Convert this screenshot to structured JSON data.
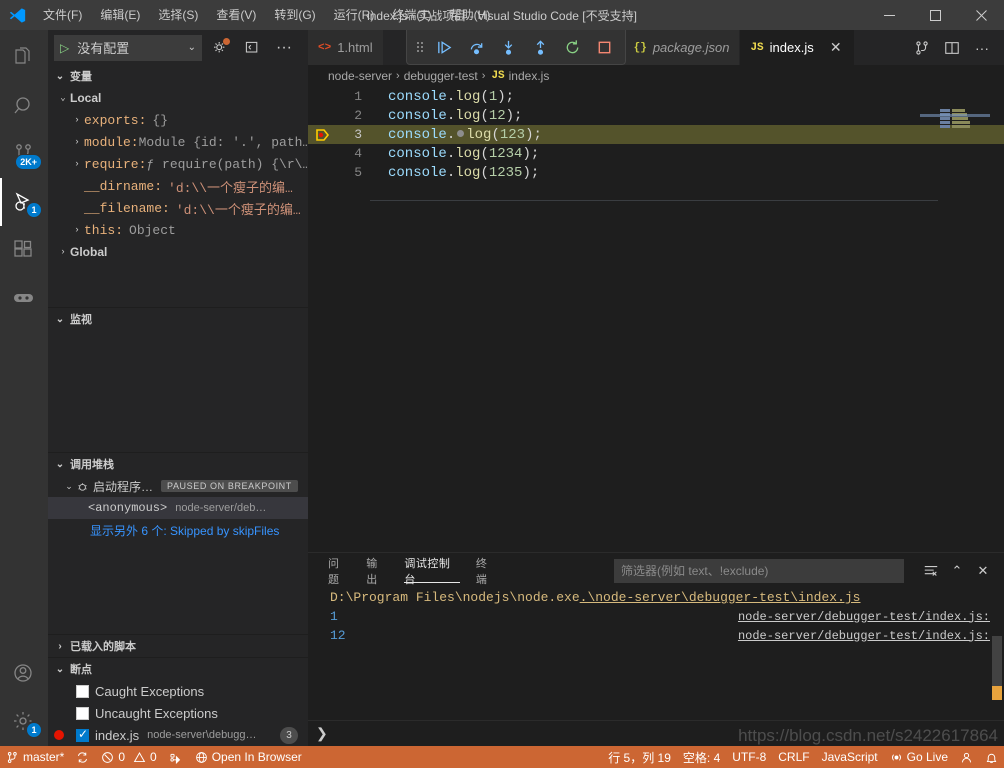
{
  "window": {
    "title": "index.js - 实战项目 - Visual Studio Code [不受支持]",
    "minimize": "—",
    "maximize": "□",
    "close": "✕"
  },
  "menu": {
    "items": [
      {
        "label": "文件(F)",
        "name": "menu-file"
      },
      {
        "label": "编辑(E)",
        "name": "menu-edit"
      },
      {
        "label": "选择(S)",
        "name": "menu-selection"
      },
      {
        "label": "查看(V)",
        "name": "menu-view"
      },
      {
        "label": "转到(G)",
        "name": "menu-go"
      },
      {
        "label": "运行(R)",
        "name": "menu-run"
      },
      {
        "label": "终端(T)",
        "name": "menu-terminal"
      },
      {
        "label": "帮助(H)",
        "name": "menu-help"
      }
    ]
  },
  "activitybar": {
    "explorer_badge": "",
    "scm_badge": "2K+",
    "debug_badge": "1",
    "settings_badge": "1"
  },
  "debugbar": {
    "config_label": "没有配置",
    "play_glyph": "▷",
    "chevron": "⌄",
    "gear_title": "打开“launch.json”",
    "more_title": "视图和更多操作...",
    "more_glyph": "···"
  },
  "debug_toolbar": {
    "continue": "继续",
    "step_over": "单步跳过",
    "step_into": "单步调试",
    "step_out": "单步跳出",
    "restart": "重启",
    "stop": "停止"
  },
  "sidebar": {
    "variables": {
      "title": "变量",
      "chevron": "⌄",
      "scopes": [
        {
          "name": "Local",
          "expanded": true,
          "chevron": "⌄",
          "rows": [
            {
              "twisty": "›",
              "name": "exports:",
              "value": "{}",
              "kind": "obj"
            },
            {
              "twisty": "›",
              "name": "module:",
              "value": "Module {id: '.', path…",
              "kind": "obj"
            },
            {
              "twisty": "›",
              "name": "require:",
              "value": "ƒ require(path) {\\r\\…",
              "kind": "fn"
            },
            {
              "twisty": "",
              "name": "__dirname:",
              "value": "'d:\\\\一个瘦子的编…",
              "kind": "str"
            },
            {
              "twisty": "",
              "name": "__filename:",
              "value": "'d:\\\\一个瘦子的编…",
              "kind": "str"
            },
            {
              "twisty": "›",
              "name": "this:",
              "value": "Object",
              "kind": "obj"
            }
          ]
        },
        {
          "name": "Global",
          "expanded": false,
          "chevron": "›",
          "rows": []
        }
      ]
    },
    "watch": {
      "title": "监视",
      "chevron": "⌄",
      "items": []
    },
    "callstack": {
      "title": "调用堆栈",
      "chevron": "⌄",
      "session": {
        "label": "启动程序…",
        "chevron": "⌄",
        "badge": "PAUSED ON BREAKPOINT"
      },
      "frames": [
        {
          "fn": "<anonymous>",
          "location": "node-server/deb…",
          "selected": true
        }
      ],
      "more": "显示另外 6 个: Skipped by skipFiles"
    },
    "loaded_scripts": {
      "title": "已载入的脚本",
      "chevron": "›"
    },
    "breakpoints": {
      "title": "断点",
      "chevron": "⌄",
      "items": [
        {
          "label": "Caught Exceptions",
          "checked": false,
          "path": "",
          "count": "",
          "dot": false
        },
        {
          "label": "Uncaught Exceptions",
          "checked": false,
          "path": "",
          "count": "",
          "dot": false
        },
        {
          "label": "index.js",
          "checked": true,
          "path": "node-server\\debugg…",
          "count": "3",
          "dot": true
        }
      ]
    }
  },
  "tabs": [
    {
      "label": "1.html",
      "icon": "html-file-icon",
      "icon_text": "<>",
      "active": false,
      "preview": false,
      "close": ""
    },
    {
      "label": "package.json",
      "icon": "json-file-icon",
      "icon_text": "{}",
      "active": false,
      "preview": true,
      "close": ""
    },
    {
      "label": "index.js",
      "icon": "js-file-icon",
      "icon_text": "JS",
      "active": true,
      "preview": false,
      "close": "✕"
    }
  ],
  "tabs_actions": {
    "split_editor": "拆分编辑器",
    "more_actions": "···"
  },
  "breadcrumb": {
    "segments": [
      "node-server",
      "debugger-test",
      "index.js"
    ],
    "separator": "›",
    "file_icon_text": "JS"
  },
  "editor": {
    "lines": [
      {
        "num": "1",
        "obj": "console",
        "dot": ".",
        "fn": "log",
        "open": "(",
        "num_arg": "1",
        "close": ");",
        "current": false,
        "breakpoint": false
      },
      {
        "num": "2",
        "obj": "console",
        "dot": ".",
        "fn": "log",
        "open": "(",
        "num_arg": "12",
        "close": ");",
        "current": false,
        "breakpoint": false
      },
      {
        "num": "3",
        "obj": "console",
        "dot": ".",
        "fn": "log",
        "open": "(",
        "num_arg": "123",
        "close": ");",
        "current": true,
        "breakpoint": true
      },
      {
        "num": "4",
        "obj": "console",
        "dot": ".",
        "fn": "log",
        "open": "(",
        "num_arg": "1234",
        "close": ");",
        "current": false,
        "breakpoint": false
      },
      {
        "num": "5",
        "obj": "console",
        "dot": ".",
        "fn": "log",
        "open": "(",
        "num_arg": "1235",
        "close": ");",
        "current": false,
        "breakpoint": false
      }
    ]
  },
  "panel": {
    "tabs": [
      {
        "label": "问题",
        "active": false,
        "name": "panel-tab-problems"
      },
      {
        "label": "输出",
        "active": false,
        "name": "panel-tab-output"
      },
      {
        "label": "调试控制台",
        "active": true,
        "name": "panel-tab-debug-console"
      },
      {
        "label": "终端",
        "active": false,
        "name": "panel-tab-terminal"
      }
    ],
    "filter_placeholder": "筛选器(例如 text、!exclude)",
    "filter_value": "",
    "actions": {
      "clear": "≡",
      "collapse": "⌃",
      "close": "✕"
    },
    "console": {
      "command_prefix": "D:\\Program Files\\nodejs\\node.exe ",
      "command_arg": ".\\node-server\\debugger-test\\index.js",
      "outputs": [
        {
          "value": "1",
          "source": "node-server/debugger-test/index.js:"
        },
        {
          "value": "12",
          "source": "node-server/debugger-test/index.js:"
        }
      ],
      "prompt": "❯"
    }
  },
  "statusbar": {
    "branch": "master*",
    "sync_icon": "sync-icon",
    "errors": "0",
    "warnings": "0",
    "ports_icon": "remote-ports-icon",
    "open_in_browser": "Open In Browser",
    "position": "行 5，列 19",
    "indent": "空格: 4",
    "encoding": "UTF-8",
    "eol": "CRLF",
    "language": "JavaScript",
    "golive": "Go Live",
    "accent_color": "#cc6633"
  },
  "watermark": "https://blog.csdn.net/s2422617864"
}
